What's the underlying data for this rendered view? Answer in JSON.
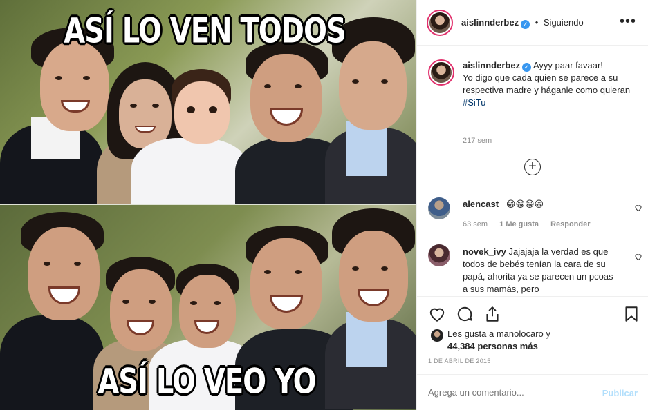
{
  "media": {
    "caption_top": "ASÍ LO VEN TODOS",
    "caption_bottom": "ASÍ LO VEO YO"
  },
  "header": {
    "username": "aislinnderbez",
    "verified_glyph": "✓",
    "separator": "•",
    "follow_status": "Siguiendo",
    "more_glyph": "•••"
  },
  "caption": {
    "username": "aislinnderbez",
    "lines": [
      "Ayyy paar favaar!",
      "Yo digo que cada quien se parece a su respectiva madre y háganle como quieran"
    ],
    "hashtag": "#SiTu",
    "time_ago": "217 sem"
  },
  "load_more_glyph": "+",
  "comments": [
    {
      "username": "alencast_",
      "text": "😁😁😁😁",
      "time": "63 sem",
      "likes": "1 Me gusta",
      "reply": "Responder"
    },
    {
      "username": "novek_ivy",
      "text": "Jajajaja la verdad es que todos de bebés tenían la cara de su papá, ahorita ya se parecen un pcoas a sus mamás, pero"
    }
  ],
  "likes": {
    "line1": "Les gusta a manolocaro y",
    "line2": "44,384 personas más"
  },
  "date": "1 DE ABRIL DE 2015",
  "add_comment": {
    "placeholder": "Agrega un comentario...",
    "publish": "Publicar"
  },
  "icons": [
    "heart-icon",
    "comment-icon",
    "share-icon",
    "bookmark-icon",
    "more-icon",
    "verified-icon",
    "plus-circle-icon"
  ],
  "colors": {
    "verified": "#3897f0",
    "hashtag": "#003569",
    "story_ring": "#e1306c",
    "muted_text": "#8e8e8e",
    "publish_disabled": "#b2dffc"
  }
}
